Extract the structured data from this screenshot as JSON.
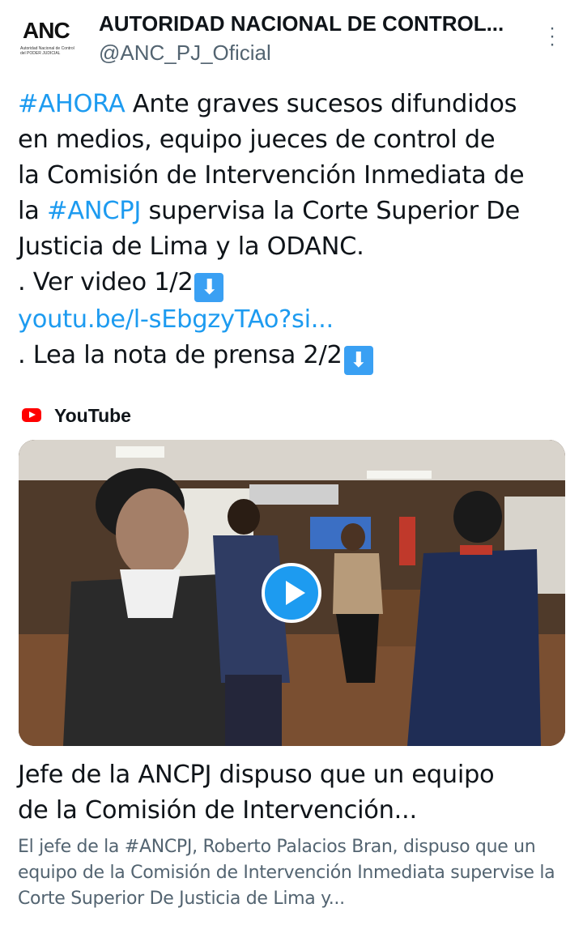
{
  "account": {
    "avatar_text": "ANC",
    "avatar_subtext": "Autoridad Nacional de Control del PODER JUDICIAL",
    "name": "AUTORIDAD NACIONAL DE CONTROL...",
    "handle": "@ANC_PJ_Oficial",
    "more_icon": "more-vertical-icon"
  },
  "tweet": {
    "line1_hashtag": "#AHORA",
    "line1_text": " Ante graves sucesos difundidos",
    "line2": "en medios, equipo jueces de control de",
    "line3": "la Comisión de Intervención Inmediata de",
    "line4_pre": "la ",
    "line4_hashtag": "#ANCPJ",
    "line4_post": " supervisa la Corte Superior De",
    "line5": "Justicia de Lima y la ODANC.",
    "line6": ". Ver video 1/2",
    "link": "youtu.be/l-sEbgzyTAo?si...",
    "line8": ". Lea la nota de prensa 2/2",
    "arrow_emoji": "⬇"
  },
  "card": {
    "source": "YouTube",
    "source_icon": "youtube-icon",
    "play_icon": "play-icon",
    "title_line1": "Jefe de la ANCPJ dispuso que un equipo",
    "title_line2": "de la Comisión de Intervención...",
    "desc_line1": "El jefe de la #ANCPJ, Roberto Palacios Bran, dispuso que un",
    "desc_line2": "equipo de la Comisión de Intervención Inmediata supervise la",
    "desc_line3": "Corte Superior De Justicia de Lima y..."
  },
  "colors": {
    "link": "#1d9bf0",
    "text": "#0f1419",
    "secondary": "#536471",
    "youtube": "#ff0000"
  }
}
